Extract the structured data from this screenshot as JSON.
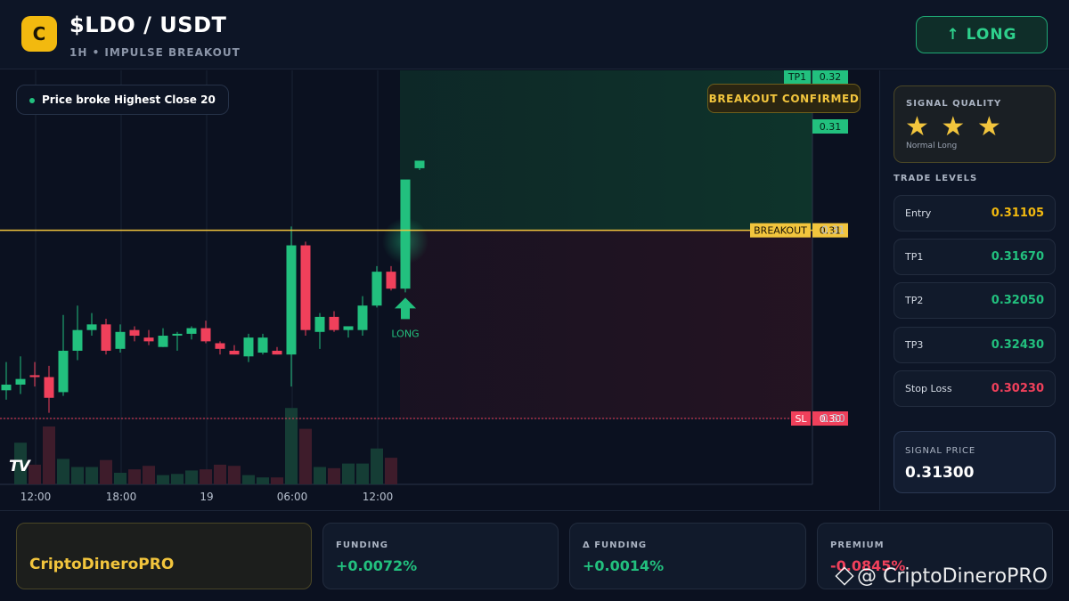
{
  "header": {
    "logo_letter": "C",
    "title": "$LDO / USDT",
    "subtitle": "1H • IMPULSE BREAKOUT",
    "direction_button": "↑ LONG"
  },
  "chart": {
    "note": "Price broke Highest Close 20",
    "badge": "BREAKOUT CONFIRMED",
    "breakout_tag": "BREAKOUT",
    "tp1_tag": "TP1",
    "sl_tag": "SL",
    "signal_marker": "LONG",
    "tv_logo": "TV"
  },
  "chart_data": {
    "type": "candlestick",
    "x_ticks": [
      "12:00",
      "18:00",
      "19",
      "06:00",
      "12:00"
    ],
    "y_ticks": [
      0.31,
      0.3
    ],
    "levels": {
      "tp1": 0.32,
      "current": 0.31,
      "breakout": 0.31,
      "sl": 0.3
    },
    "level_labels": {
      "tp1": "0.32",
      "current": "0.31",
      "breakout": "0.31",
      "sl": "0.30"
    },
    "y_range": [
      0.2965,
      0.3185
    ],
    "candles": [
      {
        "o": 0.3015,
        "h": 0.303,
        "l": 0.301,
        "c": 0.3018
      },
      {
        "o": 0.3018,
        "h": 0.3033,
        "l": 0.3013,
        "c": 0.3021
      },
      {
        "o": 0.3023,
        "h": 0.303,
        "l": 0.3017,
        "c": 0.3022
      },
      {
        "o": 0.3022,
        "h": 0.3028,
        "l": 0.3003,
        "c": 0.3011
      },
      {
        "o": 0.3014,
        "h": 0.3055,
        "l": 0.3012,
        "c": 0.3036
      },
      {
        "o": 0.3036,
        "h": 0.306,
        "l": 0.3031,
        "c": 0.3047
      },
      {
        "o": 0.3047,
        "h": 0.3056,
        "l": 0.3044,
        "c": 0.305
      },
      {
        "o": 0.305,
        "h": 0.3053,
        "l": 0.3034,
        "c": 0.3036
      },
      {
        "o": 0.3037,
        "h": 0.305,
        "l": 0.3035,
        "c": 0.3046
      },
      {
        "o": 0.3047,
        "h": 0.3049,
        "l": 0.3041,
        "c": 0.3044
      },
      {
        "o": 0.3043,
        "h": 0.3047,
        "l": 0.3039,
        "c": 0.3041
      },
      {
        "o": 0.3038,
        "h": 0.3048,
        "l": 0.3038,
        "c": 0.3044
      },
      {
        "o": 0.3045,
        "h": 0.3046,
        "l": 0.3036,
        "c": 0.3045
      },
      {
        "o": 0.3045,
        "h": 0.3049,
        "l": 0.3042,
        "c": 0.3048
      },
      {
        "o": 0.3048,
        "h": 0.3052,
        "l": 0.304,
        "c": 0.3041
      },
      {
        "o": 0.304,
        "h": 0.3041,
        "l": 0.3034,
        "c": 0.3037
      },
      {
        "o": 0.3036,
        "h": 0.3039,
        "l": 0.3034,
        "c": 0.3034
      },
      {
        "o": 0.3033,
        "h": 0.3045,
        "l": 0.303,
        "c": 0.3043
      },
      {
        "o": 0.3035,
        "h": 0.3045,
        "l": 0.3034,
        "c": 0.3043
      },
      {
        "o": 0.3036,
        "h": 0.3038,
        "l": 0.3034,
        "c": 0.3034
      },
      {
        "o": 0.3034,
        "h": 0.3102,
        "l": 0.3017,
        "c": 0.3092
      },
      {
        "o": 0.3092,
        "h": 0.3094,
        "l": 0.3044,
        "c": 0.3047
      },
      {
        "o": 0.3046,
        "h": 0.3056,
        "l": 0.3037,
        "c": 0.3054
      },
      {
        "o": 0.3054,
        "h": 0.3057,
        "l": 0.3046,
        "c": 0.3047
      },
      {
        "o": 0.3047,
        "h": 0.3049,
        "l": 0.3043,
        "c": 0.3049
      },
      {
        "o": 0.3047,
        "h": 0.3065,
        "l": 0.3044,
        "c": 0.306
      },
      {
        "o": 0.306,
        "h": 0.3081,
        "l": 0.3059,
        "c": 0.3078
      },
      {
        "o": 0.3078,
        "h": 0.3081,
        "l": 0.3068,
        "c": 0.3069
      },
      {
        "o": 0.3069,
        "h": 0.3117,
        "l": 0.3067,
        "c": 0.3127
      },
      {
        "o": 0.3133,
        "h": 0.3137,
        "l": 0.3132,
        "c": 0.3137
      }
    ],
    "volume": [
      0,
      0.36,
      0.17,
      0.5,
      0.22,
      0.15,
      0.15,
      0.21,
      0.1,
      0.13,
      0.16,
      0.08,
      0.09,
      0.12,
      0.13,
      0.17,
      0.16,
      0.08,
      0.06,
      0.06,
      0.66,
      0.48,
      0.15,
      0.14,
      0.18,
      0.18,
      0.31,
      0.23,
      0.0,
      0.0
    ],
    "signal_candle_index": 28
  },
  "sidebar": {
    "quality_title": "SIGNAL QUALITY",
    "stars": "★ ★ ★",
    "quality_sub": "Normal Long",
    "levels_title": "TRADE LEVELS",
    "levels": [
      {
        "label": "Entry",
        "value": "0.31105",
        "color": "#f2b90f"
      },
      {
        "label": "TP1",
        "value": "0.31670",
        "color": "#22c07e"
      },
      {
        "label": "TP2",
        "value": "0.32050",
        "color": "#22c07e"
      },
      {
        "label": "TP3",
        "value": "0.32430",
        "color": "#22c07e"
      },
      {
        "label": "Stop Loss",
        "value": "0.30230",
        "color": "#f0405b"
      }
    ],
    "signal_price_label": "SIGNAL PRICE",
    "signal_price": "0.31300"
  },
  "footer": {
    "brand": "CriptoDineroPRO",
    "stats": [
      {
        "label": "FUNDING",
        "value": "+0.0072%",
        "color": "#22c07e"
      },
      {
        "label": "Δ FUNDING",
        "value": "+0.0014%",
        "color": "#22c07e"
      },
      {
        "label": "PREMIUM",
        "value": "-0.0845%",
        "color": "#f0405b"
      }
    ],
    "watermark": "@ CriptoDineroPRO"
  },
  "colors": {
    "up": "#22c07e",
    "down": "#f0405b",
    "gold": "#f2c53d",
    "vol_up": "#153d35",
    "vol_down": "#3e1c2b"
  }
}
